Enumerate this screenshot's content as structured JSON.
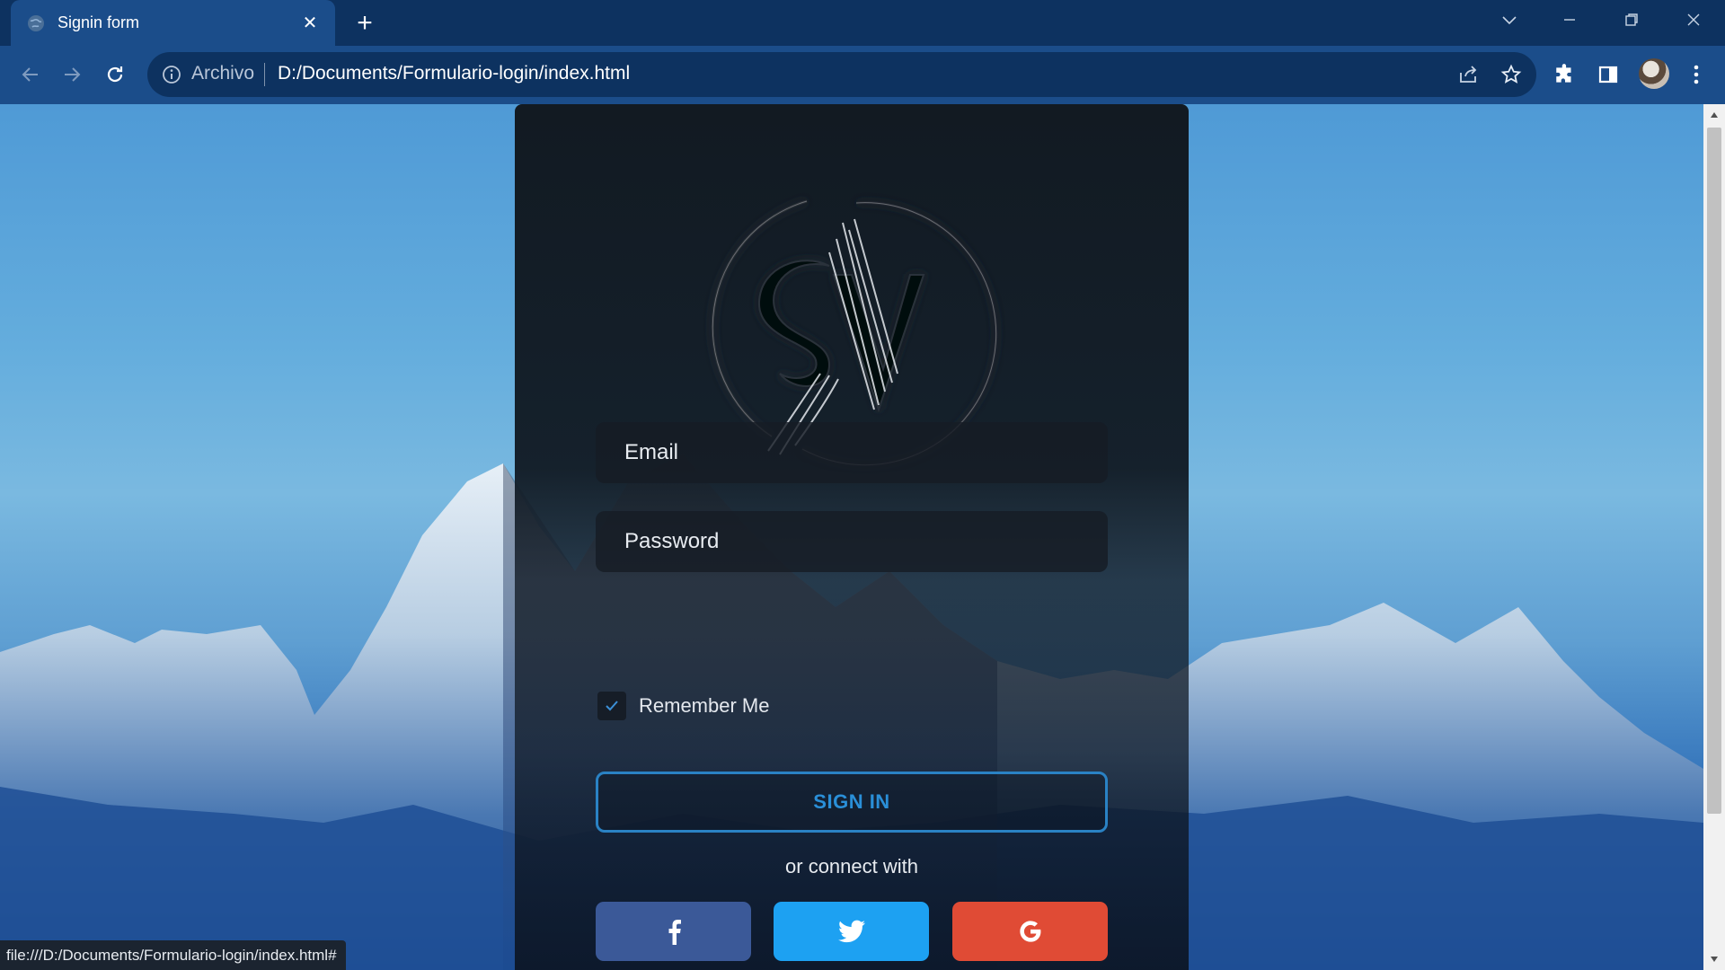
{
  "browser": {
    "tab": {
      "title": "Signin form",
      "close_symbol": "✕"
    },
    "newtab_symbol": "+",
    "address": {
      "scheme_label": "Archivo",
      "url": "D:/Documents/Formulario-login/index.html"
    },
    "status_url": "file:///D:/Documents/Formulario-login/index.html#"
  },
  "login": {
    "logo_text": "SV",
    "email_placeholder": "Email",
    "password_placeholder": "Password",
    "remember_label": "Remember Me",
    "remember_checked": true,
    "signin_label": "SIGN IN",
    "connect_text": "or connect with",
    "social": [
      {
        "name": "facebook",
        "icon": "facebook-icon",
        "color": "#3b5998"
      },
      {
        "name": "twitter",
        "icon": "twitter-icon",
        "color": "#1da1f2"
      },
      {
        "name": "google",
        "icon": "google-icon",
        "color": "#e04b35"
      }
    ]
  },
  "colors": {
    "accent": "#2a82c4",
    "tabstrip": "#0d3260",
    "toolbar": "#1b4d8a"
  }
}
